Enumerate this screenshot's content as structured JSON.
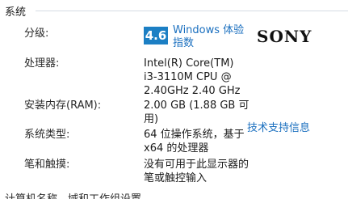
{
  "section": {
    "title": "系统"
  },
  "rating": {
    "label": "分级:",
    "score": "4.6",
    "link_text": "Windows 体验\n指数"
  },
  "oem": {
    "logo_text": "SONY"
  },
  "processor": {
    "label": "处理器:",
    "value": "Intel(R) Core(TM)\ni3-3110M CPU @\n2.40GHz   2.40 GHz"
  },
  "memory": {
    "label": "安装内存(RAM):",
    "value": "2.00 GB (1.88 GB 可\n用)"
  },
  "system_type": {
    "label": "系统类型:",
    "value": "64 位操作系统，基于\nx64 的处理器"
  },
  "support": {
    "link_text": "技术支持信息"
  },
  "pen_touch": {
    "label": "笔和触摸:",
    "value": "没有可用于此显示器的\n笔或触控输入"
  },
  "next_section_partial": {
    "text": "计算机名称、域和工作组设置"
  },
  "colors": {
    "accent": "#1c7fc4",
    "link": "#1a6fbf",
    "divider": "#d6dbe3"
  }
}
